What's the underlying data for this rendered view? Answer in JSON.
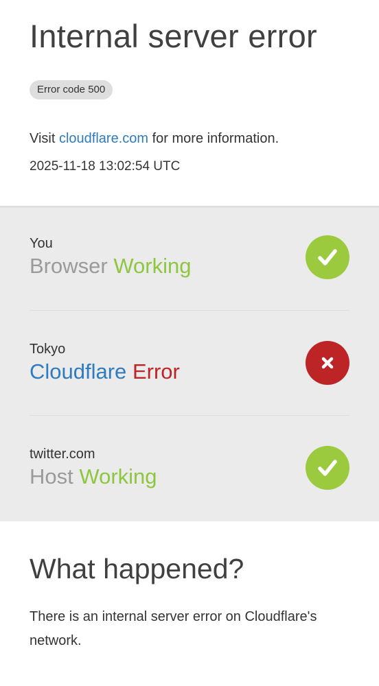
{
  "header": {
    "title": "Internal server error",
    "error_badge": "Error code 500",
    "visit_prefix": "Visit",
    "visit_link": "cloudflare.com",
    "visit_suffix": "for more information.",
    "timestamp": "2025-11-18 13:02:54 UTC"
  },
  "status": [
    {
      "location": "You",
      "name": "Browser",
      "state": "Working",
      "ok": true,
      "icon": "check-icon"
    },
    {
      "location": "Tokyo",
      "name": "Cloudflare",
      "state": "Error",
      "ok": false,
      "icon": "x-icon"
    },
    {
      "location": "twitter.com",
      "name": "Host",
      "state": "Working",
      "ok": true,
      "icon": "check-icon"
    }
  ],
  "what_happened": {
    "heading": "What happened?",
    "body": "There is an internal server error on Cloudflare's network."
  },
  "colors": {
    "working": "#8dc63f",
    "error": "#bd2426",
    "link": "#2f7bbf",
    "panel_bg": "#ebebeb"
  }
}
